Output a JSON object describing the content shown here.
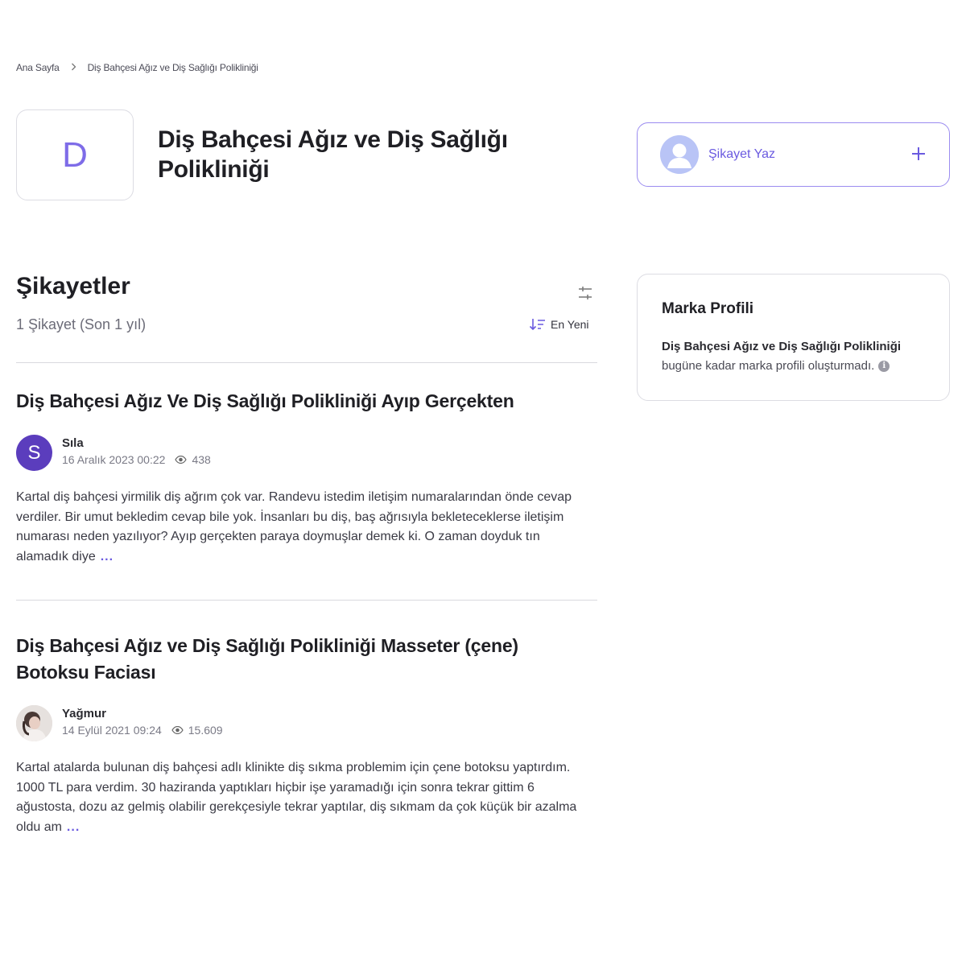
{
  "breadcrumb": {
    "home": "Ana Sayfa",
    "current": "Diş Bahçesi Ağız ve Diş Sağlığı Polikliniği"
  },
  "brand": {
    "logo_letter": "D",
    "title": "Diş Bahçesi Ağız ve Diş Sağlığı Polikliniği"
  },
  "write_complaint": {
    "label": "Şikayet Yaz",
    "icon": "plus-icon"
  },
  "complaints_section": {
    "title": "Şikayetler",
    "count_text": "1 Şikayet (Son 1 yıl)",
    "sort_label": "En Yeni"
  },
  "complaints": [
    {
      "title": "Diş Bahçesi Ağız Ve Diş Sağlığı Polikliniği Ayıp Gerçekten",
      "author": "Sıla",
      "avatar_letter": "S",
      "date": "16 Aralık 2023 00:22",
      "views": "438",
      "body": "Kartal diş bahçesi yirmilik diş ağrım çok var. Randevu istedim iletişim numaralarından önde cevap verdiler. Bir umut bekledim cevap bile yok. İnsanları bu diş, baş ağrısıyla bekleteceklerse iletişim numarası neden yazılıyor? Ayıp gerçekten paraya doymuşlar demek ki. O zaman doyduk tın alamadık diye",
      "more": "..."
    },
    {
      "title": "Diş Bahçesi Ağız ve Diş Sağlığı Polikliniği Masseter (çene) Botoksu Faciası",
      "author": "Yağmur",
      "date": "14 Eylül 2021 09:24",
      "views": "15.609",
      "body": "Kartal atalarda bulunan diş bahçesi adlı klinikte diş sıkma problemim için çene botoksu yaptırdım. 1000 TL para verdim. 30 haziranda yaptıkları hiçbir işe yaramadığı için sonra tekrar gittim 6 ağustosta, dozu az gelmiş olabilir gerekçesiyle tekrar yaptılar, diş sıkmam da çok küçük bir azalma oldu am",
      "more": "..."
    }
  ],
  "brand_profile": {
    "title": "Marka Profili",
    "brand_name": "Diş Bahçesi Ağız ve Diş Sağlığı Polikliniği",
    "text": "bugüne kadar marka profili oluşturmadı."
  },
  "colors": {
    "accent": "#6a5ae0",
    "avatar_s": "#5b3dbd",
    "border": "#dcdce3"
  }
}
